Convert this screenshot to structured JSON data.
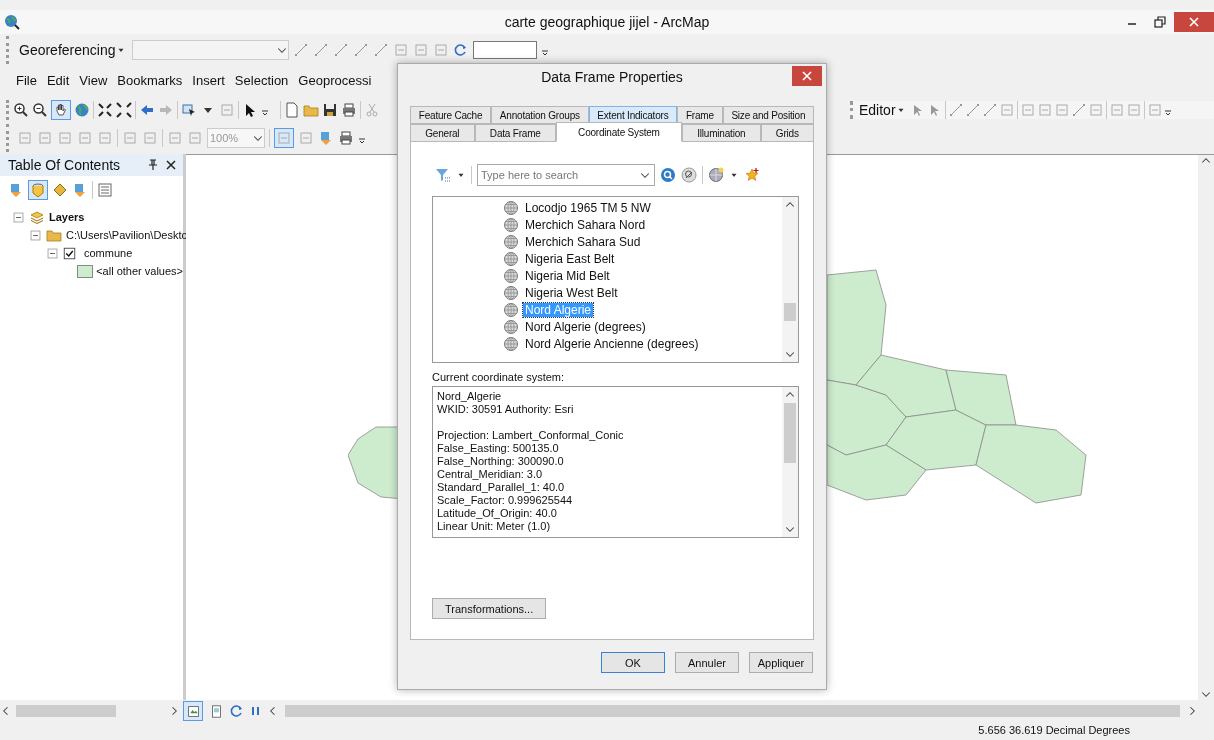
{
  "window": {
    "title": "carte geographique jijel - ArcMap"
  },
  "georeferencing_toolbar": {
    "label": "Georeferencing"
  },
  "menu": [
    {
      "label": "File"
    },
    {
      "label": "Edit"
    },
    {
      "label": "View"
    },
    {
      "label": "Bookmarks"
    },
    {
      "label": "Insert"
    },
    {
      "label": "Selection"
    },
    {
      "label": "Geoprocessi"
    }
  ],
  "tools_toolbar": {
    "zoom": "100%",
    "pan_selected": true
  },
  "editor_toolbar": {
    "label": "Editor"
  },
  "toc": {
    "title": "Table Of Contents",
    "drawing_order_selected": true,
    "tree": [
      {
        "kind": "group",
        "label": "Layers",
        "expanded": true,
        "children": [
          {
            "kind": "folder",
            "label": "C:\\Users\\Pavilion\\Desktc",
            "expanded": true,
            "children": [
              {
                "kind": "layer",
                "label": "commune",
                "checked": true,
                "expanded": true,
                "children": [
                  {
                    "kind": "symbol",
                    "label": "<all other values>",
                    "color": "#cdeccd"
                  }
                ]
              }
            ]
          }
        ]
      }
    ]
  },
  "map_view": {
    "data_view_selected": true
  },
  "dialog": {
    "title": "Data Frame Properties",
    "tab_rows": [
      [
        {
          "label": "Feature Cache",
          "selected": false,
          "hovered": false
        },
        {
          "label": "Annotation Groups",
          "selected": false,
          "hovered": false
        },
        {
          "label": "Extent Indicators",
          "selected": false,
          "hovered": true
        },
        {
          "label": "Frame",
          "selected": false,
          "hovered": false
        },
        {
          "label": "Size and Position",
          "selected": false,
          "hovered": false
        }
      ],
      [
        {
          "label": "General",
          "selected": false,
          "hovered": false
        },
        {
          "label": "Data Frame",
          "selected": false,
          "hovered": false
        },
        {
          "label": "Coordinate System",
          "selected": true,
          "hovered": false
        },
        {
          "label": "Illumination",
          "selected": false,
          "hovered": false
        },
        {
          "label": "Grids",
          "selected": false,
          "hovered": false
        }
      ]
    ],
    "search": {
      "placeholder": "Type here to search"
    },
    "systems": [
      {
        "label": "Locodjo 1965 TM 5 NW",
        "selected": false
      },
      {
        "label": "Merchich Sahara Nord",
        "selected": false
      },
      {
        "label": "Merchich Sahara Sud",
        "selected": false
      },
      {
        "label": "Nigeria East Belt",
        "selected": false
      },
      {
        "label": "Nigeria Mid Belt",
        "selected": false
      },
      {
        "label": "Nigeria West Belt",
        "selected": false
      },
      {
        "label": "Nord Algerie",
        "selected": true
      },
      {
        "label": "Nord Algerie (degrees)",
        "selected": false
      },
      {
        "label": "Nord Algerie Ancienne (degrees)",
        "selected": false
      }
    ],
    "current_label": "Current coordinate system:",
    "current_details": [
      [
        "Nord_Algerie",
        "WKID: 30591 Authority: Esri"
      ],
      [
        "Projection: Lambert_Conformal_Conic",
        "False_Easting: 500135.0",
        "False_Northing: 300090.0",
        "Central_Meridian: 3.0",
        "Standard_Parallel_1: 40.0",
        "Scale_Factor: 0.999625544",
        "Latitude_Of_Origin: 40.0",
        "Linear Unit: Meter (1.0)"
      ]
    ],
    "transformations_button": "Transformations...",
    "buttons": [
      {
        "label": "OK",
        "default": true
      },
      {
        "label": "Annuler",
        "default": false
      },
      {
        "label": "Appliquer",
        "default": false
      }
    ]
  },
  "status_bar": {
    "coordinates": "5.656  36.619 Decimal Degrees"
  }
}
